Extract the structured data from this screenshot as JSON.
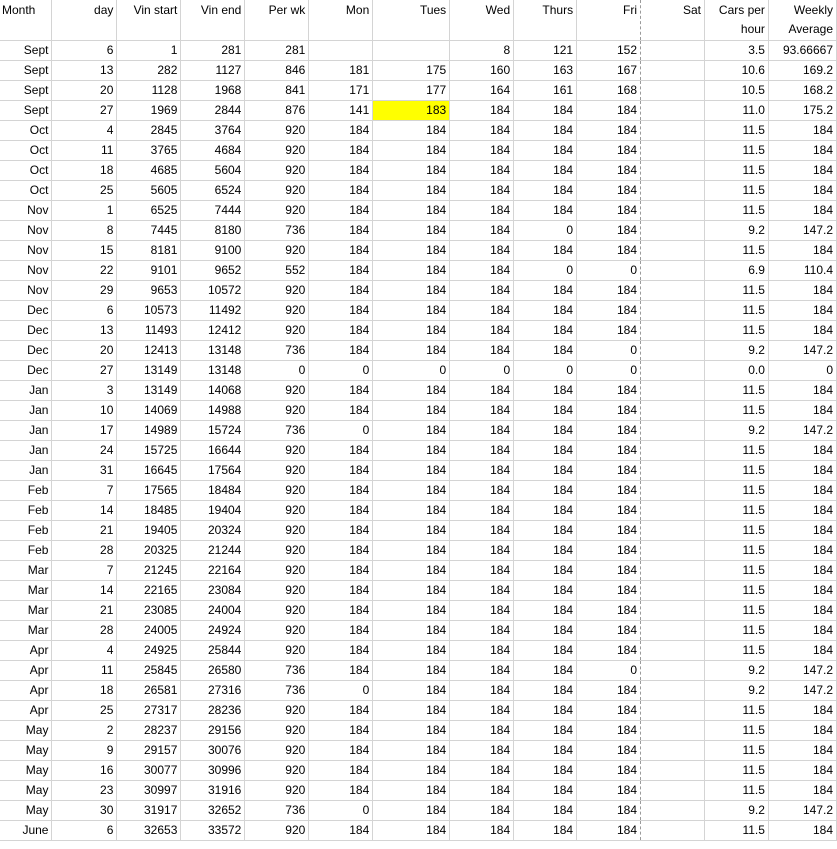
{
  "sheet": {
    "headers": [
      "Month",
      "day",
      "Vin start",
      "Vin end",
      "Per wk",
      "Mon",
      "Tues",
      "Wed",
      "Thurs",
      "Fri",
      "Sat",
      "Cars per hour",
      "Weekly Average"
    ],
    "highlight_color": "#ffff00",
    "highlight": {
      "row": 3,
      "col": 6
    },
    "rows": [
      [
        "Sept",
        "6",
        "1",
        "281",
        "281",
        "",
        "",
        "8",
        "121",
        "152",
        "",
        "3.5",
        "93.66667"
      ],
      [
        "Sept",
        "13",
        "282",
        "1127",
        "846",
        "181",
        "175",
        "160",
        "163",
        "167",
        "",
        "10.6",
        "169.2"
      ],
      [
        "Sept",
        "20",
        "1128",
        "1968",
        "841",
        "171",
        "177",
        "164",
        "161",
        "168",
        "",
        "10.5",
        "168.2"
      ],
      [
        "Sept",
        "27",
        "1969",
        "2844",
        "876",
        "141",
        "183",
        "184",
        "184",
        "184",
        "",
        "11.0",
        "175.2"
      ],
      [
        "Oct",
        "4",
        "2845",
        "3764",
        "920",
        "184",
        "184",
        "184",
        "184",
        "184",
        "",
        "11.5",
        "184"
      ],
      [
        "Oct",
        "11",
        "3765",
        "4684",
        "920",
        "184",
        "184",
        "184",
        "184",
        "184",
        "",
        "11.5",
        "184"
      ],
      [
        "Oct",
        "18",
        "4685",
        "5604",
        "920",
        "184",
        "184",
        "184",
        "184",
        "184",
        "",
        "11.5",
        "184"
      ],
      [
        "Oct",
        "25",
        "5605",
        "6524",
        "920",
        "184",
        "184",
        "184",
        "184",
        "184",
        "",
        "11.5",
        "184"
      ],
      [
        "Nov",
        "1",
        "6525",
        "7444",
        "920",
        "184",
        "184",
        "184",
        "184",
        "184",
        "",
        "11.5",
        "184"
      ],
      [
        "Nov",
        "8",
        "7445",
        "8180",
        "736",
        "184",
        "184",
        "184",
        "0",
        "184",
        "",
        "9.2",
        "147.2"
      ],
      [
        "Nov",
        "15",
        "8181",
        "9100",
        "920",
        "184",
        "184",
        "184",
        "184",
        "184",
        "",
        "11.5",
        "184"
      ],
      [
        "Nov",
        "22",
        "9101",
        "9652",
        "552",
        "184",
        "184",
        "184",
        "0",
        "0",
        "",
        "6.9",
        "110.4"
      ],
      [
        "Nov",
        "29",
        "9653",
        "10572",
        "920",
        "184",
        "184",
        "184",
        "184",
        "184",
        "",
        "11.5",
        "184"
      ],
      [
        "Dec",
        "6",
        "10573",
        "11492",
        "920",
        "184",
        "184",
        "184",
        "184",
        "184",
        "",
        "11.5",
        "184"
      ],
      [
        "Dec",
        "13",
        "11493",
        "12412",
        "920",
        "184",
        "184",
        "184",
        "184",
        "184",
        "",
        "11.5",
        "184"
      ],
      [
        "Dec",
        "20",
        "12413",
        "13148",
        "736",
        "184",
        "184",
        "184",
        "184",
        "0",
        "",
        "9.2",
        "147.2"
      ],
      [
        "Dec",
        "27",
        "13149",
        "13148",
        "0",
        "0",
        "0",
        "0",
        "0",
        "0",
        "",
        "0.0",
        "0"
      ],
      [
        "Jan",
        "3",
        "13149",
        "14068",
        "920",
        "184",
        "184",
        "184",
        "184",
        "184",
        "",
        "11.5",
        "184"
      ],
      [
        "Jan",
        "10",
        "14069",
        "14988",
        "920",
        "184",
        "184",
        "184",
        "184",
        "184",
        "",
        "11.5",
        "184"
      ],
      [
        "Jan",
        "17",
        "14989",
        "15724",
        "736",
        "0",
        "184",
        "184",
        "184",
        "184",
        "",
        "9.2",
        "147.2"
      ],
      [
        "Jan",
        "24",
        "15725",
        "16644",
        "920",
        "184",
        "184",
        "184",
        "184",
        "184",
        "",
        "11.5",
        "184"
      ],
      [
        "Jan",
        "31",
        "16645",
        "17564",
        "920",
        "184",
        "184",
        "184",
        "184",
        "184",
        "",
        "11.5",
        "184"
      ],
      [
        "Feb",
        "7",
        "17565",
        "18484",
        "920",
        "184",
        "184",
        "184",
        "184",
        "184",
        "",
        "11.5",
        "184"
      ],
      [
        "Feb",
        "14",
        "18485",
        "19404",
        "920",
        "184",
        "184",
        "184",
        "184",
        "184",
        "",
        "11.5",
        "184"
      ],
      [
        "Feb",
        "21",
        "19405",
        "20324",
        "920",
        "184",
        "184",
        "184",
        "184",
        "184",
        "",
        "11.5",
        "184"
      ],
      [
        "Feb",
        "28",
        "20325",
        "21244",
        "920",
        "184",
        "184",
        "184",
        "184",
        "184",
        "",
        "11.5",
        "184"
      ],
      [
        "Mar",
        "7",
        "21245",
        "22164",
        "920",
        "184",
        "184",
        "184",
        "184",
        "184",
        "",
        "11.5",
        "184"
      ],
      [
        "Mar",
        "14",
        "22165",
        "23084",
        "920",
        "184",
        "184",
        "184",
        "184",
        "184",
        "",
        "11.5",
        "184"
      ],
      [
        "Mar",
        "21",
        "23085",
        "24004",
        "920",
        "184",
        "184",
        "184",
        "184",
        "184",
        "",
        "11.5",
        "184"
      ],
      [
        "Mar",
        "28",
        "24005",
        "24924",
        "920",
        "184",
        "184",
        "184",
        "184",
        "184",
        "",
        "11.5",
        "184"
      ],
      [
        "Apr",
        "4",
        "24925",
        "25844",
        "920",
        "184",
        "184",
        "184",
        "184",
        "184",
        "",
        "11.5",
        "184"
      ],
      [
        "Apr",
        "11",
        "25845",
        "26580",
        "736",
        "184",
        "184",
        "184",
        "184",
        "0",
        "",
        "9.2",
        "147.2"
      ],
      [
        "Apr",
        "18",
        "26581",
        "27316",
        "736",
        "0",
        "184",
        "184",
        "184",
        "184",
        "",
        "9.2",
        "147.2"
      ],
      [
        "Apr",
        "25",
        "27317",
        "28236",
        "920",
        "184",
        "184",
        "184",
        "184",
        "184",
        "",
        "11.5",
        "184"
      ],
      [
        "May",
        "2",
        "28237",
        "29156",
        "920",
        "184",
        "184",
        "184",
        "184",
        "184",
        "",
        "11.5",
        "184"
      ],
      [
        "May",
        "9",
        "29157",
        "30076",
        "920",
        "184",
        "184",
        "184",
        "184",
        "184",
        "",
        "11.5",
        "184"
      ],
      [
        "May",
        "16",
        "30077",
        "30996",
        "920",
        "184",
        "184",
        "184",
        "184",
        "184",
        "",
        "11.5",
        "184"
      ],
      [
        "May",
        "23",
        "30997",
        "31916",
        "920",
        "184",
        "184",
        "184",
        "184",
        "184",
        "",
        "11.5",
        "184"
      ],
      [
        "May",
        "30",
        "31917",
        "32652",
        "736",
        "0",
        "184",
        "184",
        "184",
        "184",
        "",
        "9.2",
        "147.2"
      ],
      [
        "June",
        "6",
        "32653",
        "33572",
        "920",
        "184",
        "184",
        "184",
        "184",
        "184",
        "",
        "11.5",
        "184"
      ]
    ]
  }
}
